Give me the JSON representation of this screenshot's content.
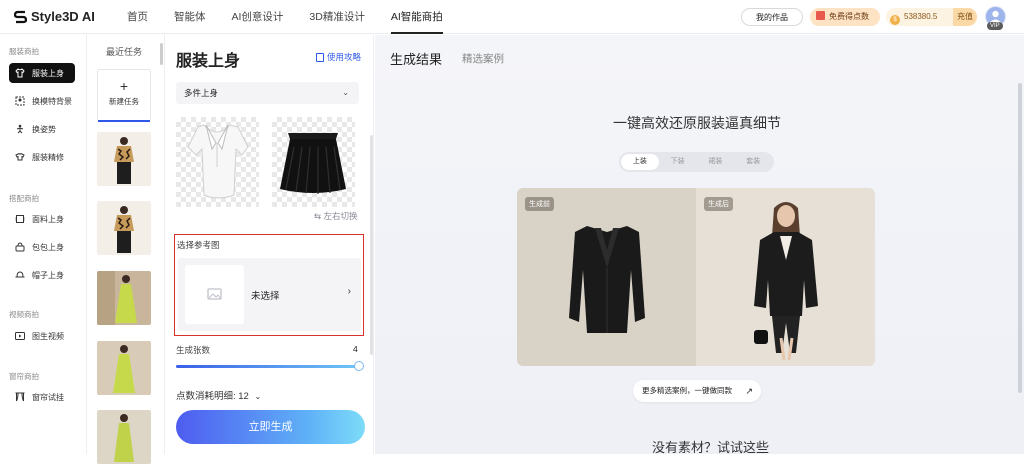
{
  "brand": {
    "name": "Style3D AI"
  },
  "nav": {
    "items": [
      "首页",
      "智能体",
      "AI创意设计",
      "3D精准设计",
      "AI智能商拍"
    ],
    "active_index": 4
  },
  "header": {
    "my_works": "我的作品",
    "free_points": "免费得点数",
    "points_balance": "538380.5",
    "recharge": "充值",
    "vip": "VIP"
  },
  "sidebar": {
    "sections": [
      {
        "title": "服装商拍",
        "items": [
          {
            "label": "服装上身",
            "icon": "garment-icon",
            "active": true
          },
          {
            "label": "换模特背景",
            "icon": "swap-model-icon",
            "active": false
          },
          {
            "label": "换姿势",
            "icon": "pose-icon",
            "active": false
          },
          {
            "label": "服装精修",
            "icon": "retouch-icon",
            "active": false
          }
        ]
      },
      {
        "title": "搭配商拍",
        "items": [
          {
            "label": "面料上身",
            "icon": "fabric-icon",
            "active": false
          },
          {
            "label": "包包上身",
            "icon": "bag-icon",
            "active": false
          },
          {
            "label": "帽子上身",
            "icon": "hat-icon",
            "active": false
          }
        ]
      },
      {
        "title": "视频商拍",
        "items": [
          {
            "label": "图生视频",
            "icon": "video-icon",
            "active": false
          }
        ]
      },
      {
        "title": "窗帘商拍",
        "items": [
          {
            "label": "窗帘试挂",
            "icon": "curtain-icon",
            "active": false
          }
        ]
      }
    ]
  },
  "tasks": {
    "title": "最近任务",
    "new_task": "新建任务",
    "thumbnails": [
      {
        "kind": "floral-shirt-model"
      },
      {
        "kind": "floral-shirt-model"
      },
      {
        "kind": "lime-dress-model"
      },
      {
        "kind": "lime-dress-model"
      },
      {
        "kind": "lime-dress-model"
      }
    ]
  },
  "form": {
    "title": "服装上身",
    "guide": "使用攻略",
    "mode_select": "多件上身",
    "swap_label": "⇆ 左右切换",
    "reference_label": "选择参考图",
    "reference_value": "未选择",
    "count_label": "生成张数",
    "count_value": "4",
    "count_fraction": 1.0,
    "cost_label": "点数消耗明细: 12",
    "generate_button": "立即生成"
  },
  "main": {
    "tab_results": "生成结果",
    "tab_cases": "精选案例",
    "hero_title": "一键高效还原服装逼真细节",
    "segments": [
      "上装",
      "下装",
      "裙装",
      "套装"
    ],
    "active_segment": 0,
    "before_tag": "生成前",
    "after_tag": "生成后",
    "more_cases": "更多精选案例，一键做同款",
    "no_material": "没有素材？试试这些"
  },
  "colors": {
    "accent_blue": "#2e58e8",
    "highlight_red": "#d9302c",
    "free_points_bg": "#fde2c4",
    "balance_bg": "#fdf3e3"
  }
}
